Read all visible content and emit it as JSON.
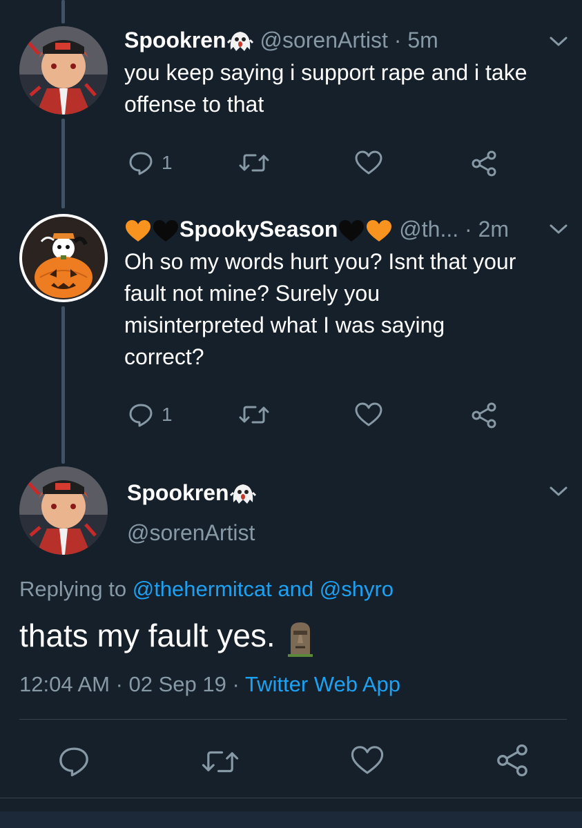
{
  "tweet1": {
    "display_name": "Spookren",
    "handle": "@sorenArtist",
    "time": "· 5m",
    "text_line1": "you keep saying i support rape and i take",
    "text_line2": "offense to that",
    "reply_count": "1"
  },
  "tweet2": {
    "display_name": "SpookySeason",
    "handle": "@th...",
    "time": "· 2m",
    "text_line1": "Oh so my words hurt you? Isnt that your",
    "text_line2": "fault not mine? Surely you",
    "text_line3": "misinterpreted what I was saying",
    "text_line4": "correct?",
    "reply_count": "1"
  },
  "main_tweet": {
    "display_name": "Spookren",
    "handle": "@sorenArtist",
    "replying_prefix": "Replying to",
    "reply_user1": "@thehermitcat",
    "reply_and": "and",
    "reply_user2": "@shyro",
    "text": "thats my fault yes.",
    "timestamp": "12:04 AM · 02 Sep 19 ·",
    "client": "Twitter Web App"
  },
  "colors": {
    "background": "#15202b",
    "secondary_text": "#8899a6",
    "link": "#1da1f2",
    "thread_line": "#3d5466",
    "divider": "#38444d"
  },
  "icons": {
    "reply": "reply-icon",
    "retweet": "retweet-icon",
    "like": "heart-icon",
    "share": "share-icon",
    "menu": "chevron-down-icon",
    "ghost": "ghost-emoji-icon",
    "orange_heart": "orange-heart-icon",
    "black_heart": "black-heart-icon",
    "moai": "moai-emoji-icon"
  }
}
